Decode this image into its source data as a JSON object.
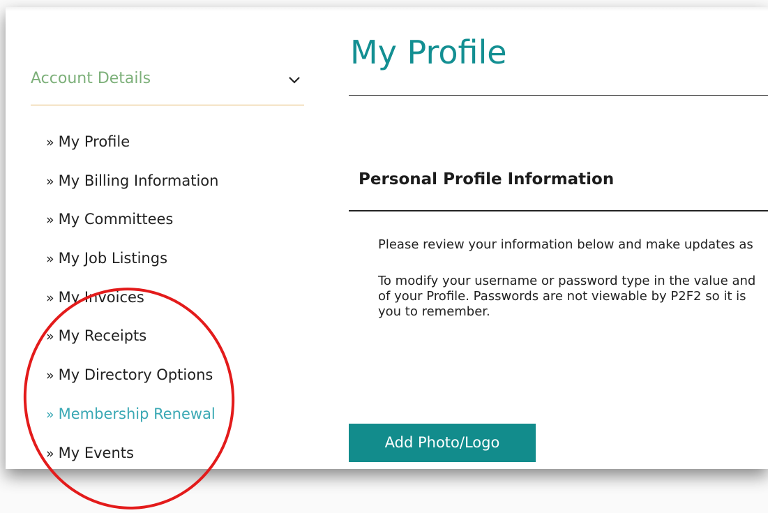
{
  "sidebar": {
    "header": "Account Details",
    "chevron_icon": "chevron-down-icon",
    "arrow_prefix": "»",
    "items": [
      {
        "label": "My Profile"
      },
      {
        "label": "My Billing Information"
      },
      {
        "label": "My Committees"
      },
      {
        "label": "My Job Listings"
      },
      {
        "label": "My Invoices"
      },
      {
        "label": "My Receipts"
      },
      {
        "label": "My Directory Options"
      },
      {
        "label": "Membership Renewal",
        "active": true
      },
      {
        "label": "My Events"
      }
    ]
  },
  "main": {
    "title": "My Profile",
    "section_title": "Personal Profile Information",
    "para1": "Please review your information below and make updates as",
    "para2_lines": [
      "To modify your username or password type in the value and",
      "of your Profile. Passwords are not viewable by P2F2 so it is",
      "you to remember."
    ],
    "add_photo_button": "Add Photo/Logo"
  },
  "colors": {
    "accent_teal": "#138f92",
    "active_link": "#3aa8b4",
    "header_green": "#7db07a",
    "header_rule": "#e2b35e",
    "button_bg": "#128c8c",
    "annotation_red": "#e31b1b"
  }
}
